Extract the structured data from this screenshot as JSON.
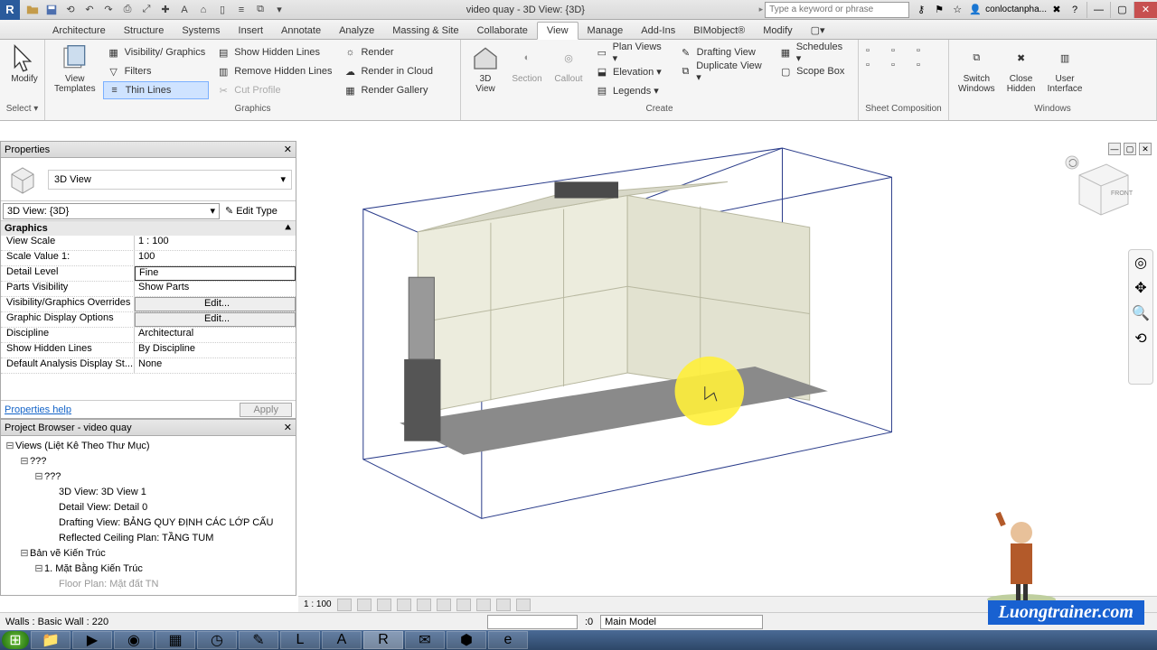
{
  "title": "video quay - 3D View: {3D}",
  "search_placeholder": "Type a keyword or phrase",
  "search_hint": "conloctanpha...",
  "tabs": [
    "Architecture",
    "Structure",
    "Systems",
    "Insert",
    "Annotate",
    "Analyze",
    "Massing & Site",
    "Collaborate",
    "View",
    "Manage",
    "Add-Ins",
    "BIMobject®",
    "Modify"
  ],
  "active_tab": "View",
  "ribbon": {
    "select": {
      "modify": "Modify",
      "caption": "Select ▾"
    },
    "graphics": {
      "view_templates": "View\nTemplates",
      "vis": "Visibility/ Graphics",
      "filters": "Filters",
      "thin": "Thin  Lines",
      "show_hidden": "Show  Hidden Lines",
      "remove_hidden": "Remove  Hidden Lines",
      "cut_profile": "Cut  Profile",
      "render": "Render",
      "render_cloud": "Render  in Cloud",
      "render_gallery": "Render  Gallery",
      "caption": "Graphics"
    },
    "create": {
      "3d": "3D\nView",
      "section": "Section",
      "callout": "Callout",
      "plan": "Plan  Views ▾",
      "elev": "Elevation ▾",
      "legends": "Legends ▾",
      "drafting": "Drafting  View",
      "dup": "Duplicate  View ▾",
      "sched": "Schedules ▾",
      "scope": "Scope  Box",
      "caption": "Create"
    },
    "sheetcomp": {
      "caption": "Sheet Composition"
    },
    "windows": {
      "switch": "Switch\nWindows",
      "close": "Close\nHidden",
      "ui": "User\nInterface",
      "caption": "Windows"
    }
  },
  "properties": {
    "title": "Properties",
    "type": "3D View",
    "instance": "3D View: {3D}",
    "edit_type": "Edit Type",
    "category": "Graphics",
    "rows": [
      {
        "k": "View Scale",
        "v": "1 : 100"
      },
      {
        "k": "Scale Value    1:",
        "v": "100"
      },
      {
        "k": "Detail Level",
        "v": "Fine",
        "hl": true
      },
      {
        "k": "Parts Visibility",
        "v": "Show Parts"
      },
      {
        "k": "Visibility/Graphics Overrides",
        "v": "Edit...",
        "btn": true
      },
      {
        "k": "Graphic Display Options",
        "v": "Edit...",
        "btn": true
      },
      {
        "k": "Discipline",
        "v": "Architectural"
      },
      {
        "k": "Show Hidden Lines",
        "v": "By Discipline"
      },
      {
        "k": "Default Analysis Display St...",
        "v": "None"
      }
    ],
    "help": "Properties help",
    "apply": "Apply"
  },
  "browser": {
    "title": "Project Browser - video quay",
    "root": "Views (Liệt Kê Theo Thư Mục)",
    "n1": "???",
    "n2": "???",
    "items": [
      "3D View: 3D View 1",
      "Detail View: Detail 0",
      "Drafting View: BẢNG QUY ĐỊNH CÁC LỚP CẤU",
      "Reflected Ceiling Plan: TẦNG TUM"
    ],
    "n3": "Bản vẽ Kiến Trúc",
    "n4": "1. Mặt Bằng Kiến Trúc",
    "n5": "Floor Plan: Mặt đất TN"
  },
  "vcb": {
    "scale": "1 : 100"
  },
  "status": {
    "left": "Walls : Basic Wall : 220",
    "zero": ":0",
    "model": "Main Model"
  },
  "watermark": "Luongtrainer.com",
  "navcube": {
    "front": "FRONT"
  }
}
